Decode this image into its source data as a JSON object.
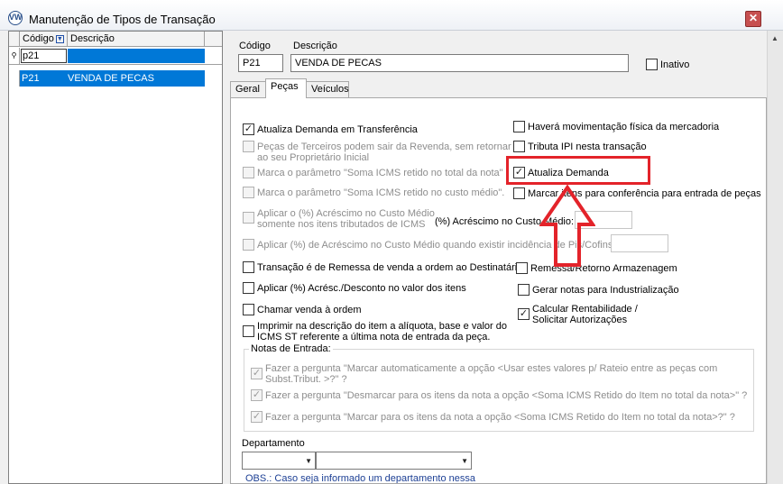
{
  "window": {
    "title": "Manutenção de Tipos de Transação",
    "close_glyph": "✕",
    "app_icon": "VW"
  },
  "grid": {
    "columns": [
      "Código",
      "Descrição"
    ],
    "filter_value": "p21",
    "rows": [
      {
        "codigo": "P21",
        "descricao": "VENDA DE PECAS"
      }
    ]
  },
  "form": {
    "codigo_label": "Código",
    "descricao_label": "Descrição",
    "codigo_value": "P21",
    "descricao_value": "VENDA DE PECAS",
    "inativo_label": "Inativo"
  },
  "tabs": [
    {
      "label": "Geral",
      "active": false
    },
    {
      "label": "Peças",
      "active": true
    },
    {
      "label": "Veículos",
      "active": false
    }
  ],
  "left_options": [
    {
      "label": "Atualiza Demanda em Transferência",
      "checked": true,
      "disabled": false
    },
    {
      "label": "Peças de Terceiros podem sair da Revenda, sem retornar",
      "label2": "ao seu Proprietário Inicial",
      "checked": false,
      "disabled": true
    },
    {
      "label": "Marca o parâmetro \"Soma ICMS retido no total da nota\"",
      "checked": false,
      "disabled": true
    },
    {
      "label": "Marca o parâmetro \"Soma ICMS retido no custo médio\".",
      "checked": false,
      "disabled": true
    },
    {
      "label": "Aplicar o (%) Acréscimo no Custo Médio",
      "label2": "somente nos itens tributados de ICMS",
      "checked": false,
      "disabled": true
    },
    {
      "label": "Aplicar (%) de Acréscimo no Custo Médio quando existir incidência de Pis/Cofins:",
      "checked": false,
      "disabled": true
    },
    {
      "label": "Transação é de Remessa de venda a ordem ao Destinatário",
      "checked": false,
      "disabled": false
    },
    {
      "label": "Aplicar (%) Acrésc./Desconto no valor dos itens",
      "checked": false,
      "disabled": false
    },
    {
      "label": "Chamar venda à ordem",
      "checked": false,
      "disabled": false
    },
    {
      "label": "Imprimir na descrição do item a alíquota, base e valor do",
      "label2": "ICMS ST referente a última nota de entrada da peça.",
      "checked": false,
      "disabled": false
    }
  ],
  "acrescimo_label": "(%) Acréscimo no Custo Médio:",
  "right_options": [
    {
      "label": "Haverá movimentação física da mercadoria",
      "checked": false
    },
    {
      "label": "Tributa IPI nesta transação",
      "checked": false
    },
    {
      "label": "Atualiza Demanda",
      "checked": true
    },
    {
      "label": "Marcar itens para conferência para entrada de peças",
      "checked": false
    },
    {
      "label": "Remessa/Retorno Armazenagem",
      "checked": false
    },
    {
      "label": "Gerar notas para Industrialização",
      "checked": false
    },
    {
      "label": "Calcular Rentabilidade /",
      "label2": "Solicitar Autorizações",
      "checked": true
    }
  ],
  "notas_entrada": {
    "title": "Notas de Entrada:",
    "items": [
      {
        "label": "Fazer a pergunta \"Marcar automaticamente a opção <Usar estes valores p/ Rateio entre as peças com",
        "label2": "Subst.Tribut. >?\" ?",
        "checked": true
      },
      {
        "label": "Fazer a pergunta \"Desmarcar para os itens da nota a opção <Soma ICMS Retido do Item no total da nota>\" ?",
        "checked": true
      },
      {
        "label": "Fazer a pergunta \"Marcar para os itens da nota a opção <Soma ICMS Retido do Item no total da nota>?\" ?",
        "checked": true
      }
    ]
  },
  "departamento": {
    "label": "Departamento",
    "value1": "",
    "value2": ""
  },
  "obs_text": "OBS.: Caso seja informado um departamento nessa",
  "check_glyph": "✓",
  "arrow_glyph": "▼",
  "annotation_color": "#e3232a"
}
